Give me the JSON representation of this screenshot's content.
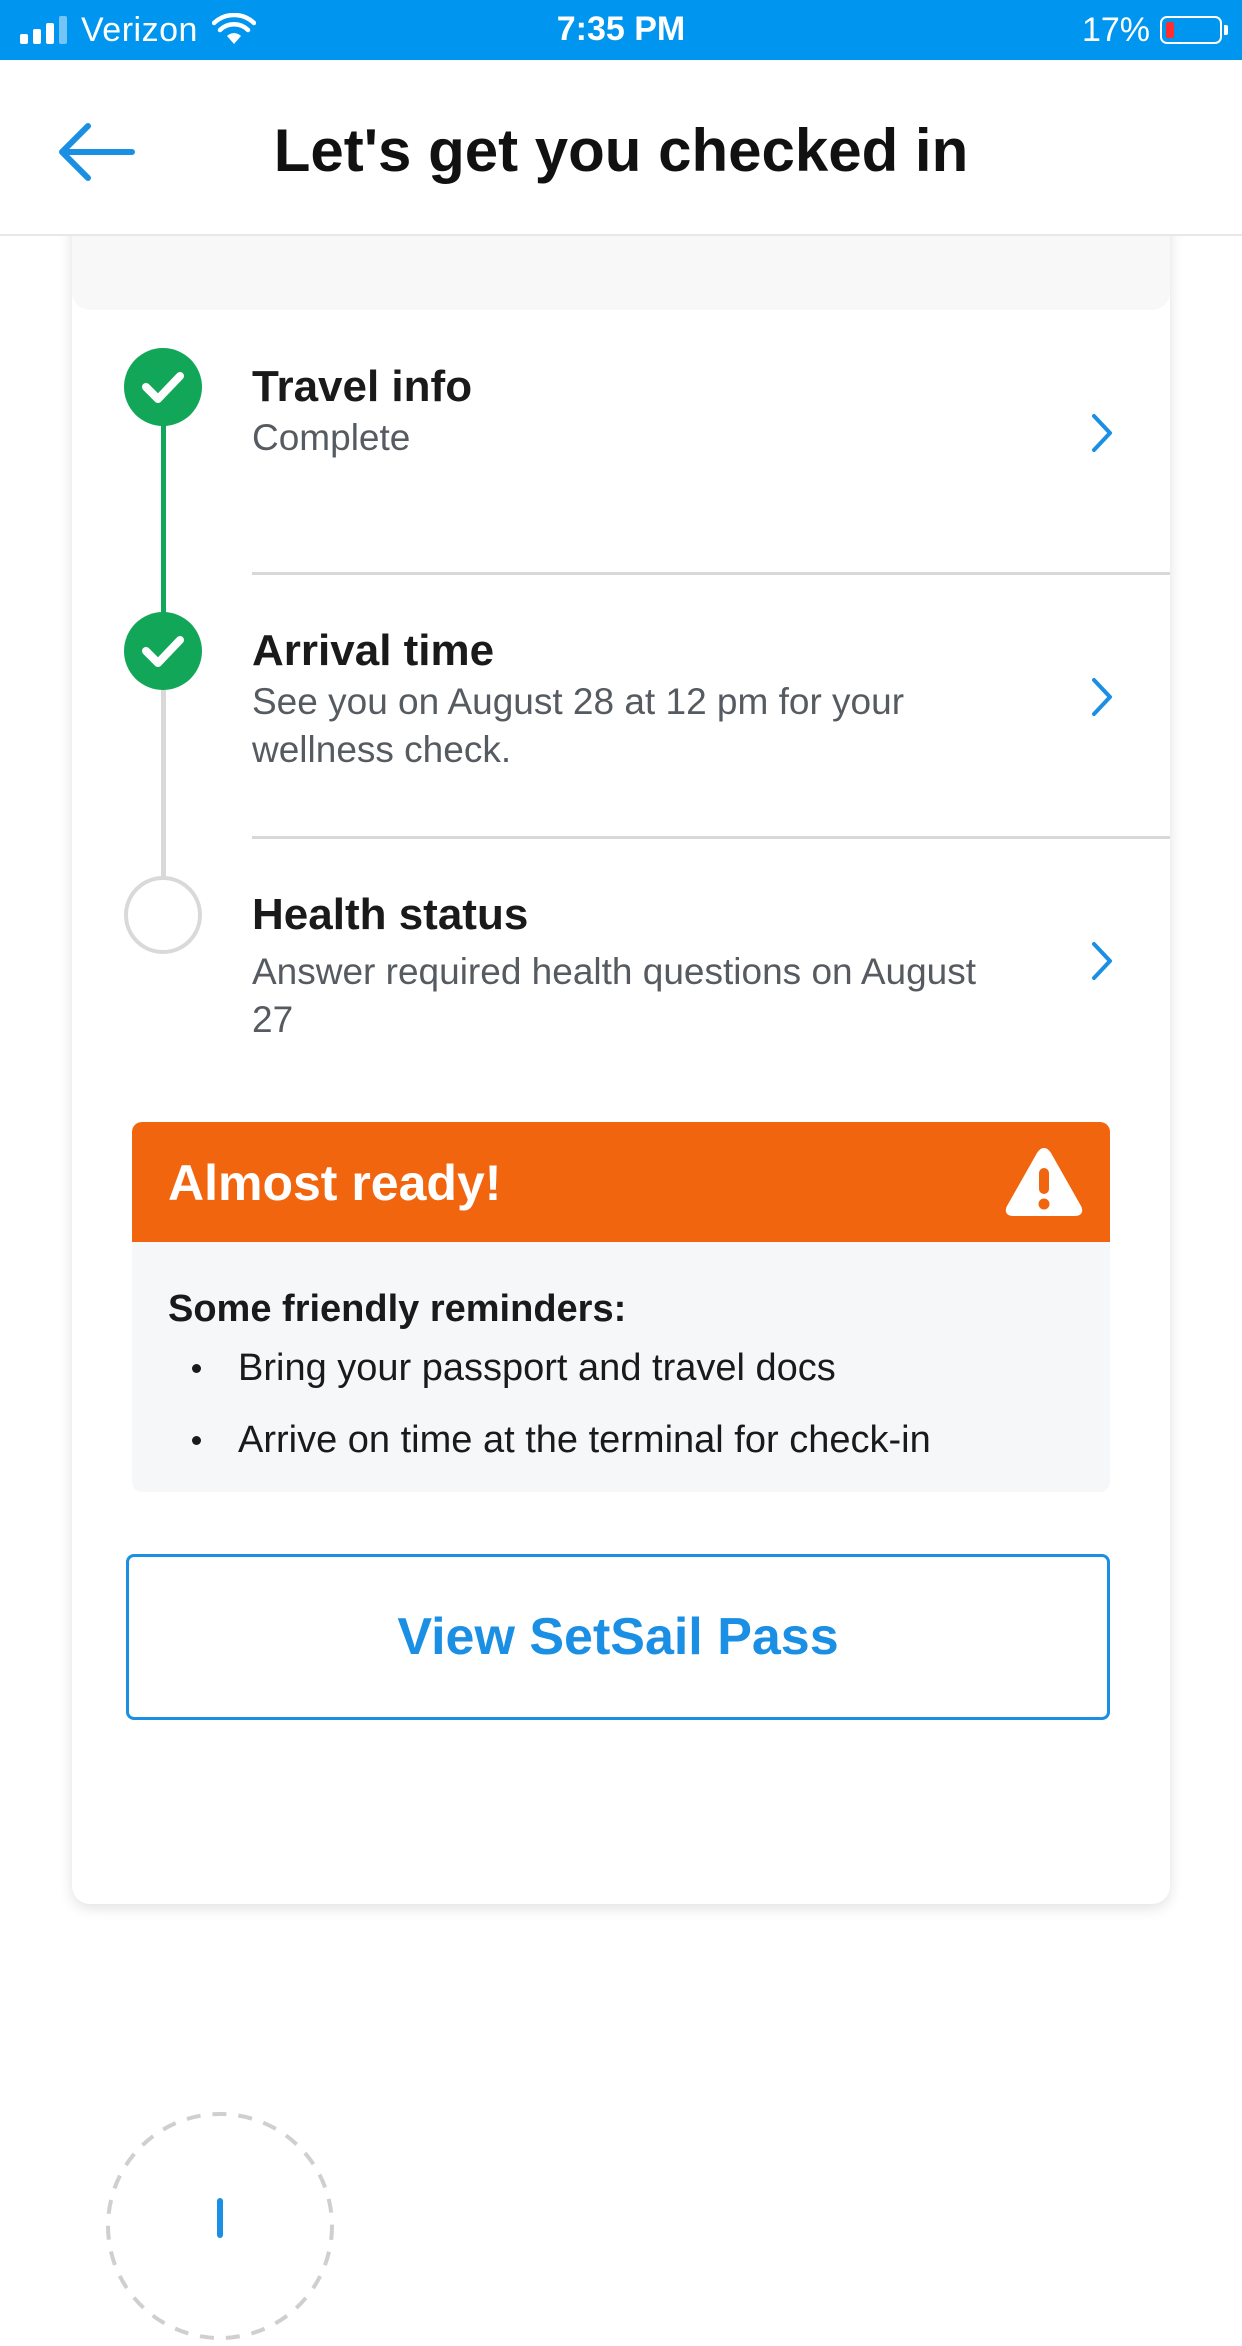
{
  "status_bar": {
    "carrier": "Verizon",
    "time": "7:35 PM",
    "battery_percent": "17%",
    "battery_level": 0.17,
    "battery_color": "#ff2d2d"
  },
  "header": {
    "title": "Let's get you checked in",
    "back_icon": "arrow-left-icon"
  },
  "steps": [
    {
      "title": "Travel info",
      "subtitle": "Complete",
      "status": "complete"
    },
    {
      "title": "Arrival time",
      "subtitle": "See you on August 28 at 12 pm for your wellness check.",
      "status": "complete"
    },
    {
      "title": "Health status",
      "subtitle": "Answer required health questions on August 27",
      "status": "pending"
    }
  ],
  "alert": {
    "title": "Almost ready!",
    "icon": "warning-icon",
    "subhead": "Some friendly reminders:",
    "items": [
      "Bring your passport and travel docs",
      "Arrive on time at the terminal for check-in"
    ]
  },
  "pass_button": {
    "label": "View SetSail Pass"
  },
  "colors": {
    "status_bar": "#0095ee",
    "accent_blue": "#1a8fe3",
    "success_green": "#12a659",
    "alert_orange": "#f2650f"
  }
}
